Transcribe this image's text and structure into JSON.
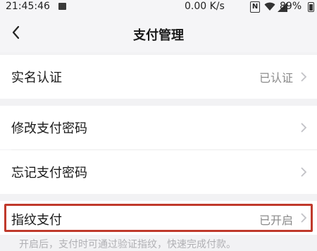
{
  "status_bar": {
    "time": "21:45:46",
    "speed": "0.00 K/s",
    "nfc": "N",
    "battery_pct": "89%",
    "icons": [
      "image-icon",
      "nfc-icon",
      "wifi-icon",
      "signal-icon",
      "battery-icon"
    ]
  },
  "nav": {
    "title": "支付管理",
    "back_icon": "chevron-left-icon"
  },
  "rows": [
    {
      "label": "实名认证",
      "value": "已认证"
    },
    {
      "label": "修改支付密码",
      "value": ""
    },
    {
      "label": "忘记支付密码",
      "value": ""
    },
    {
      "label": "指纹支付",
      "value": "已开启"
    }
  ],
  "hint": "开启后，支付时可通过验证指纹，快速完成付款。",
  "colors": {
    "background": "#f2f2f4",
    "row": "#ffffff",
    "highlight_border": "#c0392b",
    "value_text": "#8a8a8a"
  }
}
